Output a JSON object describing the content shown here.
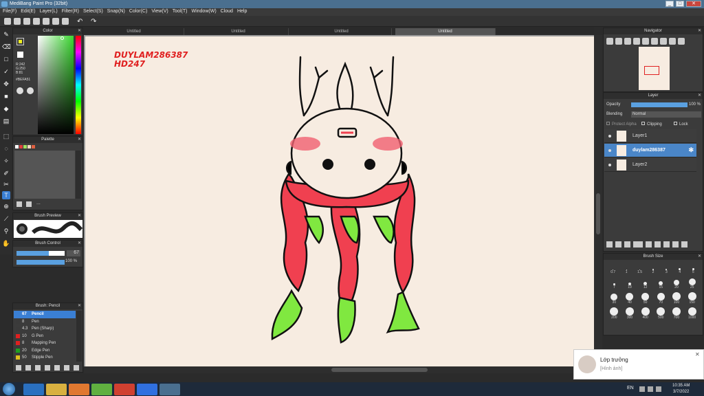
{
  "app": {
    "title": "MediBang Paint Pro (32bit)"
  },
  "window_controls": [
    "_",
    "□",
    "✕"
  ],
  "menu": [
    "File(F)",
    "Edit(E)",
    "Layer(L)",
    "Filter(R)",
    "Select(S)",
    "Snap(N)",
    "Color(C)",
    "View(V)",
    "Tool(T)",
    "Window(W)",
    "Cloud",
    "Help"
  ],
  "tabs": [
    "Untitled",
    "Untitled",
    "Untitled",
    "Untitled"
  ],
  "color_panel": {
    "title": "Color",
    "rgb": [
      "R:242",
      "G:250",
      "B:81"
    ],
    "hex": "#BEFA51",
    "accent": "#f0f020"
  },
  "palette_panel": {
    "title": "Palette",
    "more": "..."
  },
  "brush_preview": {
    "title": "Brush Preview"
  },
  "brush_control": {
    "title": "Brush Control",
    "size": "67",
    "opacity": "100 %",
    "size_fraction": 0.67,
    "opacity_fraction": 1.0
  },
  "brush_panel": {
    "title": "Brush: Pencil",
    "items": [
      {
        "num": "67",
        "name": "Pencil",
        "selected": true,
        "color": "#3a7fd4"
      },
      {
        "num": "8",
        "name": "Pen",
        "selected": false,
        "color": "#3a3a3a"
      },
      {
        "num": "4.3",
        "name": "Pen (Sharp)",
        "selected": false,
        "color": "#3a3a3a"
      },
      {
        "num": "10",
        "name": "G Pen",
        "selected": false,
        "color": "#e02020"
      },
      {
        "num": "8",
        "name": "Mapping Pen",
        "selected": false,
        "color": "#e02020"
      },
      {
        "num": "20",
        "name": "Edge Pen",
        "selected": false,
        "color": "#20a020"
      },
      {
        "num": "50",
        "name": "Stipple Pen",
        "selected": false,
        "color": "#e0c020"
      }
    ]
  },
  "canvas": {
    "watermark_line1": "DUYLAM286387",
    "watermark_line2": "HD247"
  },
  "navigator": {
    "title": "Navigator"
  },
  "layer_panel": {
    "title": "Layer",
    "opacity_label": "Opacity",
    "opacity_value": "100 %",
    "opacity_fraction": 1.0,
    "blending_label": "Blending",
    "blending_value": "Normal",
    "protect_alpha": "Protect Alpha",
    "clipping": "Clipping",
    "lock": "Lock",
    "layers": [
      {
        "name": "Layer1",
        "selected": false
      },
      {
        "name": "duylam286387",
        "selected": true
      },
      {
        "name": "Layer2",
        "selected": false
      }
    ]
  },
  "brush_size": {
    "title": "Brush Size",
    "rows": [
      [
        "0.7",
        "1",
        "1.5",
        "2",
        "3",
        "4",
        "5"
      ],
      [
        "7",
        "10",
        "12",
        "15",
        "20",
        "25"
      ],
      [
        "30",
        "40",
        "50",
        "70",
        "100",
        "150"
      ],
      [
        "200",
        "300",
        "400",
        "500",
        "700",
        "1000"
      ]
    ]
  },
  "notification": {
    "name": "Lớp trưởng",
    "message": "[Hình ảnh]",
    "close": "✕"
  },
  "taskbar": {
    "lang": "EN",
    "time": "10:35 AM",
    "date": "3/7/2022"
  }
}
